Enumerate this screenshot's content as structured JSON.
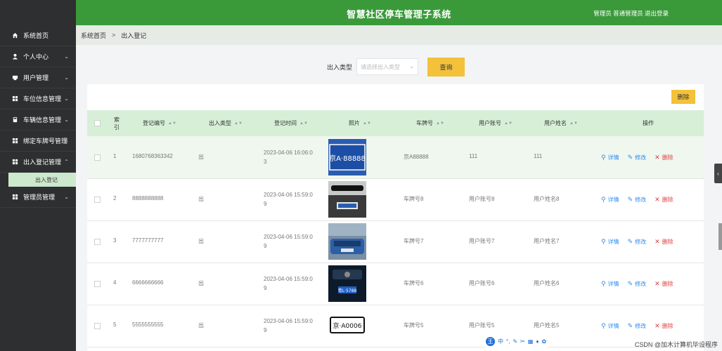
{
  "app": {
    "title": "智慧社区停车管理子系统",
    "user_info": "管理员 普通管理员 退出登录"
  },
  "sidebar": {
    "items": [
      {
        "label": "系统首页",
        "icon": "home-icon",
        "chevron": ""
      },
      {
        "label": "个人中心",
        "icon": "user-icon",
        "chevron": "⌄"
      },
      {
        "label": "用户管理",
        "icon": "users-icon",
        "chevron": "⌄"
      },
      {
        "label": "车位信息管理",
        "icon": "grid-icon",
        "chevron": "⌄"
      },
      {
        "label": "车辆信息管理",
        "icon": "car-icon",
        "chevron": "⌄"
      },
      {
        "label": "绑定车牌号管理",
        "icon": "grid-icon",
        "chevron": "⌄"
      },
      {
        "label": "出入登记管理",
        "icon": "grid-icon",
        "chevron": "⌃"
      },
      {
        "label": "管理员管理",
        "icon": "grid-icon",
        "chevron": "⌄"
      }
    ],
    "active_sub": "出入登记"
  },
  "breadcrumb": {
    "home": "系统首页",
    "separator": ">",
    "current": "出入登记"
  },
  "search": {
    "label": "出入类型",
    "placeholder": "请选择出入类型",
    "button": "查询"
  },
  "toolbar": {
    "delete_label": "删除"
  },
  "table": {
    "headers": [
      "索引",
      "登记编号",
      "出入类型",
      "登记时间",
      "照片",
      "车牌号",
      "用户账号",
      "用户姓名",
      "操作"
    ],
    "rows": [
      {
        "index": "1",
        "code": "1680768363342",
        "type": "出",
        "time_line1": "2023-04-06 16:06:0",
        "time_line2": "3",
        "plate": "京A88888",
        "account": "111",
        "name": "111"
      },
      {
        "index": "2",
        "code": "8888888888",
        "type": "出",
        "time_line1": "2023-04-06 15:59:0",
        "time_line2": "9",
        "plate": "车牌号8",
        "account": "用户账号8",
        "name": "用户姓名8"
      },
      {
        "index": "3",
        "code": "7777777777",
        "type": "出",
        "time_line1": "2023-04-06 15:59:0",
        "time_line2": "9",
        "plate": "车牌号7",
        "account": "用户账号7",
        "name": "用户姓名7"
      },
      {
        "index": "4",
        "code": "6666666666",
        "type": "出",
        "time_line1": "2023-04-06 15:59:0",
        "time_line2": "9",
        "plate": "车牌号6",
        "account": "用户账号6",
        "name": "用户姓名6"
      },
      {
        "index": "5",
        "code": "5555555555",
        "type": "出",
        "time_line1": "2023-04-06 15:59:0",
        "time_line2": "9",
        "plate": "车牌号5",
        "account": "用户账号5",
        "name": "用户姓名5"
      }
    ],
    "photo_texts": [
      "京A·88888",
      "",
      "",
      "粤L·5788",
      "京·A0006"
    ],
    "actions": {
      "detail": "详情",
      "edit": "修改",
      "delete": "删除"
    }
  },
  "ime": {
    "logo": "王",
    "mode": "中"
  },
  "watermark": "CSDN @加木计算机毕设程序",
  "colors": {
    "primary": "#3a9a3a",
    "accent": "#f3c13a",
    "sidebar": "#2e2f31",
    "link": "#2d8cf0",
    "danger": "#e04040"
  }
}
